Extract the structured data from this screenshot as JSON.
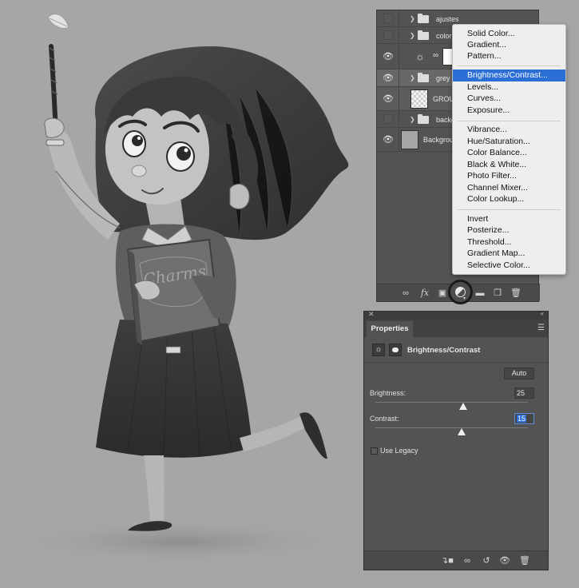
{
  "layers_panel": {
    "layers": [
      {
        "name": "ajustes",
        "type": "group",
        "visible": false
      },
      {
        "name": "color",
        "type": "group",
        "visible": false
      },
      {
        "name": "",
        "type": "adjustment",
        "visible": true
      },
      {
        "name": "grey",
        "type": "group",
        "visible": true,
        "selected": true
      },
      {
        "name": "GROU",
        "type": "layer",
        "visible": true
      },
      {
        "name": "backg",
        "type": "group",
        "visible": false
      },
      {
        "name": "Backgrou",
        "type": "layer",
        "visible": true
      }
    ],
    "footer_icons": [
      "link-icon",
      "fx-icon",
      "mask-icon",
      "adjustment-icon",
      "folder-icon",
      "new-layer-icon",
      "trash-icon"
    ],
    "fx_label": "fx"
  },
  "adjustment_menu": {
    "groups": [
      [
        "Solid Color...",
        "Gradient...",
        "Pattern..."
      ],
      [
        "Brightness/Contrast...",
        "Levels...",
        "Curves...",
        "Exposure..."
      ],
      [
        "Vibrance...",
        "Hue/Saturation...",
        "Color Balance...",
        "Black & White...",
        "Photo Filter...",
        "Channel Mixer...",
        "Color Lookup..."
      ],
      [
        "Invert",
        "Posterize...",
        "Threshold...",
        "Gradient Map...",
        "Selective Color..."
      ]
    ],
    "highlighted": "Brightness/Contrast..."
  },
  "properties_panel": {
    "tab_label": "Properties",
    "title": "Brightness/Contrast",
    "auto_label": "Auto",
    "brightness_label": "Brightness:",
    "brightness_value": "25",
    "contrast_label": "Contrast:",
    "contrast_value": "15",
    "brightness_fraction": 0.575,
    "contrast_fraction": 0.566,
    "legacy_label": "Use Legacy",
    "legacy_checked": false
  },
  "artwork": {
    "book_title": "Charms"
  },
  "colors": {
    "canvas_background": "#a6a6a6",
    "panel_background": "#535353",
    "menu_highlight": "#2a6ed6"
  }
}
